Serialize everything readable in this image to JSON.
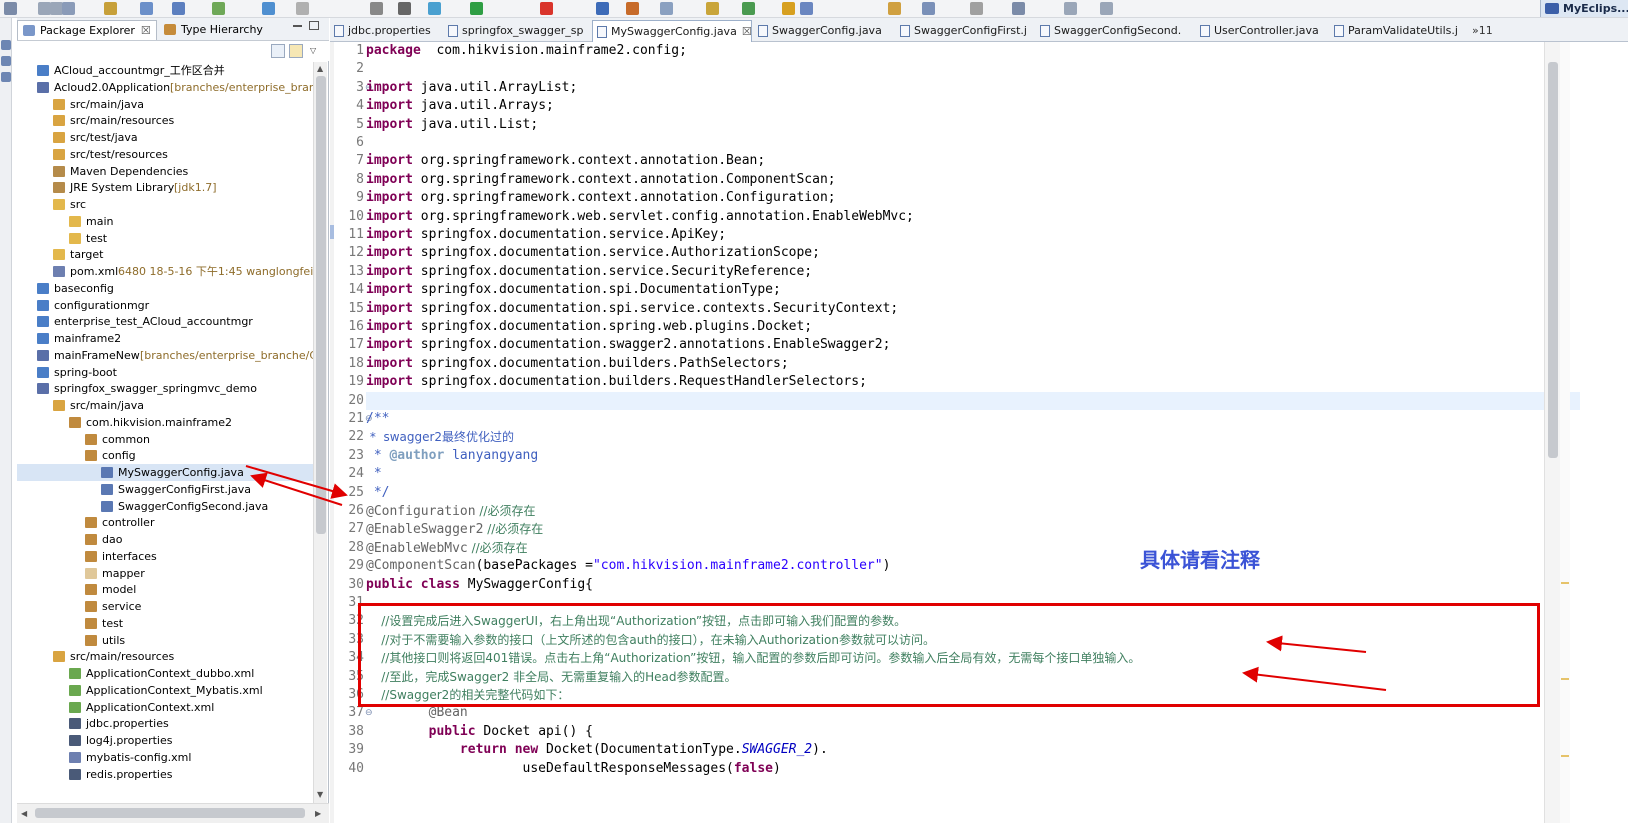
{
  "perspective": {
    "label": "MyEclips..."
  },
  "explorer": {
    "tabs": [
      {
        "label": "Package Explorer",
        "close": "☒",
        "active": true
      },
      {
        "label": "Type Hierarchy",
        "active": false
      }
    ]
  },
  "tree": [
    {
      "label": "ACloud_accountmgr_工作区合并",
      "deco": "",
      "indent": 0,
      "icon": "project-icon"
    },
    {
      "label": "Acloud2.0Application",
      "deco": " [branches/enterprise_branche/",
      "indent": 0,
      "icon": "maven-project-icon"
    },
    {
      "label": "src/main/java",
      "deco": "",
      "indent": 1,
      "icon": "source-folder-icon"
    },
    {
      "label": "src/main/resources",
      "deco": "",
      "indent": 1,
      "icon": "source-folder-icon"
    },
    {
      "label": "src/test/java",
      "deco": "",
      "indent": 1,
      "icon": "source-folder-icon"
    },
    {
      "label": "src/test/resources",
      "deco": "",
      "indent": 1,
      "icon": "source-folder-icon"
    },
    {
      "label": "Maven Dependencies",
      "deco": "",
      "indent": 1,
      "icon": "library-icon"
    },
    {
      "label": "JRE System Library",
      "deco": " [jdk1.7]",
      "indent": 1,
      "icon": "library-icon"
    },
    {
      "label": "src",
      "deco": "",
      "indent": 1,
      "icon": "folder-icon"
    },
    {
      "label": "main",
      "deco": "",
      "indent": 2,
      "icon": "folder-icon"
    },
    {
      "label": "test",
      "deco": "",
      "indent": 2,
      "icon": "folder-icon"
    },
    {
      "label": "target",
      "deco": "",
      "indent": 1,
      "icon": "folder-icon"
    },
    {
      "label": "pom.xml",
      "deco": " 6480  18-5-16 下午1:45  wanglongfei",
      "indent": 1,
      "icon": "xml-file-icon"
    },
    {
      "label": "baseconfig",
      "deco": "",
      "indent": 0,
      "icon": "project-icon"
    },
    {
      "label": "configurationmgr",
      "deco": "",
      "indent": 0,
      "icon": "project-icon"
    },
    {
      "label": "enterprise_test_ACloud_accountmgr",
      "deco": "",
      "indent": 0,
      "icon": "project-icon"
    },
    {
      "label": "mainframe2",
      "deco": "",
      "indent": 0,
      "icon": "project-icon"
    },
    {
      "label": "mainFrameNew",
      "deco": " [branches/enterprise_branche/Cloud",
      "indent": 0,
      "icon": "maven-project-icon"
    },
    {
      "label": "spring-boot",
      "deco": "",
      "indent": 0,
      "icon": "project-icon"
    },
    {
      "label": "springfox_swagger_springmvc_demo",
      "deco": "",
      "indent": 0,
      "icon": "maven-project-icon"
    },
    {
      "label": "src/main/java",
      "deco": "",
      "indent": 1,
      "icon": "source-folder-icon"
    },
    {
      "label": "com.hikvision.mainframe2",
      "deco": "",
      "indent": 2,
      "icon": "package-icon"
    },
    {
      "label": "common",
      "deco": "",
      "indent": 3,
      "icon": "package-icon"
    },
    {
      "label": "config",
      "deco": "",
      "indent": 3,
      "icon": "package-icon"
    },
    {
      "label": "MySwaggerConfig.java",
      "deco": "",
      "indent": 4,
      "icon": "java-file-icon",
      "selected": true
    },
    {
      "label": "SwaggerConfigFirst.java",
      "deco": "",
      "indent": 4,
      "icon": "java-file-icon"
    },
    {
      "label": "SwaggerConfigSecond.java",
      "deco": "",
      "indent": 4,
      "icon": "java-file-icon"
    },
    {
      "label": "controller",
      "deco": "",
      "indent": 3,
      "icon": "package-icon"
    },
    {
      "label": "dao",
      "deco": "",
      "indent": 3,
      "icon": "package-icon"
    },
    {
      "label": "interfaces",
      "deco": "",
      "indent": 3,
      "icon": "package-icon"
    },
    {
      "label": "mapper",
      "deco": "",
      "indent": 3,
      "icon": "empty-package-icon"
    },
    {
      "label": "model",
      "deco": "",
      "indent": 3,
      "icon": "package-icon"
    },
    {
      "label": "service",
      "deco": "",
      "indent": 3,
      "icon": "package-icon"
    },
    {
      "label": "test",
      "deco": "",
      "indent": 3,
      "icon": "package-icon"
    },
    {
      "label": "utils",
      "deco": "",
      "indent": 3,
      "icon": "package-icon"
    },
    {
      "label": "src/main/resources",
      "deco": "",
      "indent": 1,
      "icon": "source-folder-icon"
    },
    {
      "label": "ApplicationContext_dubbo.xml",
      "deco": "",
      "indent": 2,
      "icon": "spring-xml-icon"
    },
    {
      "label": "ApplicationContext_Mybatis.xml",
      "deco": "",
      "indent": 2,
      "icon": "spring-xml-icon"
    },
    {
      "label": "ApplicationContext.xml",
      "deco": "",
      "indent": 2,
      "icon": "spring-xml-icon"
    },
    {
      "label": "jdbc.properties",
      "deco": "",
      "indent": 2,
      "icon": "properties-file-icon"
    },
    {
      "label": "log4j.properties",
      "deco": "",
      "indent": 2,
      "icon": "properties-file-icon"
    },
    {
      "label": "mybatis-config.xml",
      "deco": "",
      "indent": 2,
      "icon": "xml-file-icon"
    },
    {
      "label": "redis.properties",
      "deco": "",
      "indent": 2,
      "icon": "properties-file-icon"
    }
  ],
  "editor_tabs": [
    {
      "label": "jdbc.properties",
      "active": false
    },
    {
      "label": "springfox_swagger_sp",
      "active": false
    },
    {
      "label": "MySwaggerConfig.java",
      "active": true,
      "close": "☒"
    },
    {
      "label": "SwaggerConfig.java",
      "active": false
    },
    {
      "label": "SwaggerConfigFirst.j",
      "active": false
    },
    {
      "label": "SwaggerConfigSecond.",
      "active": false
    },
    {
      "label": "UserController.java",
      "active": false
    },
    {
      "label": "ParamValidateUtils.j",
      "active": false
    },
    {
      "label": "»11",
      "active": false
    }
  ],
  "code_lines": [
    {
      "n": "1",
      "segs": [
        [
          "kw",
          "package"
        ],
        [
          "",
          "  com.hikvision.mainframe2.config;"
        ]
      ]
    },
    {
      "n": "2",
      "segs": []
    },
    {
      "n": "3",
      "fold": "⊖",
      "segs": [
        [
          "kw",
          "import"
        ],
        [
          "",
          " java.util.ArrayList;"
        ]
      ]
    },
    {
      "n": "4",
      "segs": [
        [
          "kw",
          "import"
        ],
        [
          "",
          " java.util.Arrays;"
        ]
      ]
    },
    {
      "n": "5",
      "segs": [
        [
          "kw",
          "import"
        ],
        [
          "",
          " java.util.List;"
        ]
      ]
    },
    {
      "n": "6",
      "segs": []
    },
    {
      "n": "7",
      "segs": [
        [
          "kw",
          "import"
        ],
        [
          "",
          " org.springframework.context.annotation.Bean;"
        ]
      ]
    },
    {
      "n": "8",
      "segs": [
        [
          "kw",
          "import"
        ],
        [
          "",
          " org.springframework.context.annotation.ComponentScan;"
        ]
      ]
    },
    {
      "n": "9",
      "segs": [
        [
          "kw",
          "import"
        ],
        [
          "",
          " org.springframework.context.annotation.Configuration;"
        ]
      ]
    },
    {
      "n": "10",
      "segs": [
        [
          "kw",
          "import"
        ],
        [
          "",
          " org.springframework.web.servlet.config.annotation.EnableWebMvc;"
        ]
      ]
    },
    {
      "n": "11",
      "segs": [
        [
          "kw",
          "import"
        ],
        [
          "",
          " springfox.documentation.service.ApiKey;"
        ]
      ]
    },
    {
      "n": "12",
      "segs": [
        [
          "kw",
          "import"
        ],
        [
          "",
          " springfox.documentation.service.AuthorizationScope;"
        ]
      ]
    },
    {
      "n": "13",
      "segs": [
        [
          "kw",
          "import"
        ],
        [
          "",
          " springfox.documentation.service.SecurityReference;"
        ]
      ]
    },
    {
      "n": "14",
      "segs": [
        [
          "kw",
          "import"
        ],
        [
          "",
          " springfox.documentation.spi.DocumentationType;"
        ]
      ]
    },
    {
      "n": "15",
      "segs": [
        [
          "kw",
          "import"
        ],
        [
          "",
          " springfox.documentation.spi.service.contexts.SecurityContext;"
        ]
      ]
    },
    {
      "n": "16",
      "segs": [
        [
          "kw",
          "import"
        ],
        [
          "",
          " springfox.documentation.spring.web.plugins.Docket;"
        ]
      ]
    },
    {
      "n": "17",
      "segs": [
        [
          "kw",
          "import"
        ],
        [
          "",
          " springfox.documentation.swagger2.annotations.EnableSwagger2;"
        ]
      ]
    },
    {
      "n": "18",
      "segs": [
        [
          "kw",
          "import"
        ],
        [
          "",
          " springfox.documentation.builders.PathSelectors;"
        ]
      ]
    },
    {
      "n": "19",
      "segs": [
        [
          "kw",
          "import"
        ],
        [
          "",
          " springfox.documentation.builders.RequestHandlerSelectors;"
        ]
      ]
    },
    {
      "n": "20",
      "segs": [],
      "highlight": true
    },
    {
      "n": "21",
      "fold": "⊖",
      "segs": [
        [
          "jd",
          "/**"
        ]
      ]
    },
    {
      "n": "22",
      "segs": [
        [
          "jd",
          " *  swagger2最终优化过的"
        ]
      ]
    },
    {
      "n": "23",
      "segs": [
        [
          "jd",
          " * "
        ],
        [
          "jdtag",
          "@author"
        ],
        [
          "jd",
          " lanyangyang"
        ]
      ]
    },
    {
      "n": "24",
      "segs": [
        [
          "jd",
          " *"
        ]
      ]
    },
    {
      "n": "25",
      "segs": [
        [
          "jd",
          " */"
        ]
      ]
    },
    {
      "n": "26",
      "segs": [
        [
          "ann",
          "@Configuration"
        ],
        [
          "cmt",
          " //必须存在"
        ]
      ]
    },
    {
      "n": "27",
      "segs": [
        [
          "ann",
          "@EnableSwagger2"
        ],
        [
          "cmt",
          " //必须存在"
        ]
      ]
    },
    {
      "n": "28",
      "segs": [
        [
          "ann",
          "@EnableWebMvc"
        ],
        [
          "cmt",
          " //必须存在"
        ]
      ]
    },
    {
      "n": "29",
      "segs": [
        [
          "ann",
          "@ComponentScan"
        ],
        [
          "",
          "(basePackages ="
        ],
        [
          "str",
          "\"com.hikvision.mainframe2.controller\""
        ],
        [
          "",
          ")"
        ]
      ]
    },
    {
      "n": "30",
      "segs": [
        [
          "kw",
          "public class"
        ],
        [
          "",
          " MySwaggerConfig{"
        ]
      ]
    },
    {
      "n": "31",
      "segs": []
    },
    {
      "n": "32",
      "segs": [
        [
          "cmt",
          "    //设置完成后进入SwaggerUI，右上角出现“Authorization”按钮，点击即可输入我们配置的参数。"
        ]
      ]
    },
    {
      "n": "33",
      "segs": [
        [
          "cmt",
          "    //对于不需要输入参数的接口（上文所述的包含auth的接口），在未输入Authorization参数就可以访问。"
        ]
      ]
    },
    {
      "n": "34",
      "segs": [
        [
          "cmt",
          "    //其他接口则将返回401错误。点击右上角“Authorization”按钮，输入配置的参数后即可访问。参数输入后全局有效，无需每个接口单独输入。"
        ]
      ]
    },
    {
      "n": "35",
      "segs": [
        [
          "cmt",
          "    //至此，完成Swagger2 非全局、无需重复输入的Head参数配置。"
        ]
      ]
    },
    {
      "n": "36",
      "segs": [
        [
          "cmt",
          "    //Swagger2的相关完整代码如下："
        ]
      ]
    },
    {
      "n": "37",
      "fold": "⊖",
      "segs": [
        [
          "ann",
          "        @Bean"
        ]
      ]
    },
    {
      "n": "38",
      "segs": [
        [
          "kw",
          "        public"
        ],
        [
          "",
          " Docket api() {"
        ]
      ]
    },
    {
      "n": "39",
      "segs": [
        [
          "kw",
          "            return new"
        ],
        [
          "",
          " Docket(DocumentationType."
        ],
        [
          "it",
          "SWAGGER_2"
        ],
        [
          "",
          ")."
        ]
      ]
    },
    {
      "n": "40",
      "segs": [
        [
          "",
          "                    useDefaultResponseMessages("
        ],
        [
          "kw",
          "false"
        ],
        [
          "",
          ")"
        ]
      ]
    }
  ],
  "annotation_note": "具体请看注释",
  "colors": {
    "red_box": "#e00000",
    "note": "#3b53d6",
    "keyword": "#7f0055",
    "comment": "#3f7f5f",
    "string": "#2a00ff"
  }
}
